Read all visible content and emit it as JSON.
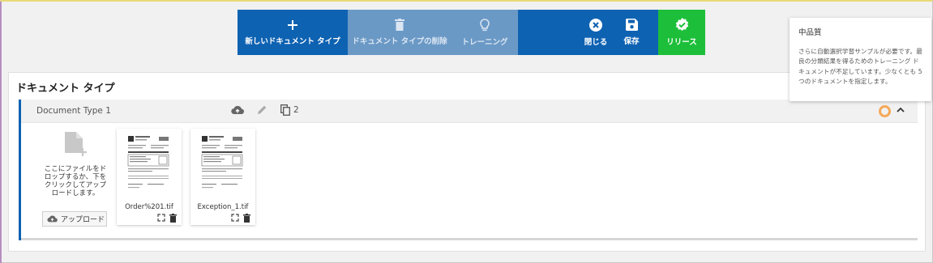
{
  "toolbar": {
    "new_doc_type": "新しいドキュメント タイプ",
    "delete_doc_type": "ドキュメント タイプの削除",
    "training": "トレーニング",
    "close": "閉じる",
    "save": "保存",
    "release": "リリース"
  },
  "tooltip": {
    "title": "中品質",
    "body": "さらに自動選択学習サンプルが必要です。最良の分類結果を得るためのトレーニング ドキュメントが不足しています。少なくとも 5 つのドキュメントを指定します。"
  },
  "panel": {
    "title": "ドキュメント タイプ"
  },
  "document_type": {
    "name": "Document Type 1",
    "copies": "2"
  },
  "upload": {
    "drop_text": "ここにファイルをドロップするか、下をクリックしてアップロードします。",
    "button_label": "アップロード"
  },
  "documents": [
    {
      "name": "Order%201.tif"
    },
    {
      "name": "Exception_1.tif"
    }
  ],
  "colors": {
    "toolbar_blue": "#0e62b2",
    "disabled_blue": "#6b99c6",
    "release_green": "#1dbf3a",
    "quality_orange": "#f5a95a"
  },
  "icons": {
    "new": "plus-icon",
    "delete": "trash-icon",
    "training": "lightbulb-icon",
    "close": "close-circle-icon",
    "save": "floppy-disk-icon",
    "release": "check-badge-icon"
  }
}
